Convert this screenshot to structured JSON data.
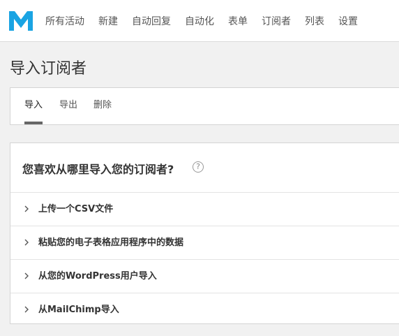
{
  "nav": {
    "logo_icon": "mailpoet-m-logo",
    "brand_color": "#1aa4e3",
    "items": [
      "所有活动",
      "新建",
      "自动回复",
      "自动化",
      "表单",
      "订阅者",
      "列表",
      "设置"
    ]
  },
  "page": {
    "title": "导入订阅者"
  },
  "tabs": [
    {
      "label": "导入",
      "active": true
    },
    {
      "label": "导出",
      "active": false
    },
    {
      "label": "删除",
      "active": false
    }
  ],
  "panel": {
    "heading": "您喜欢从哪里导入您的订阅者?",
    "help_icon": "?",
    "options": [
      {
        "label": "上传一个CSV文件",
        "icon": "chevron-right-icon"
      },
      {
        "label": "粘贴您的电子表格应用程序中的数据",
        "icon": "chevron-right-icon"
      },
      {
        "label": "从您的WordPress用户导入",
        "icon": "chevron-right-icon"
      },
      {
        "label": "从MailChimp导入",
        "icon": "chevron-right-icon"
      }
    ]
  }
}
